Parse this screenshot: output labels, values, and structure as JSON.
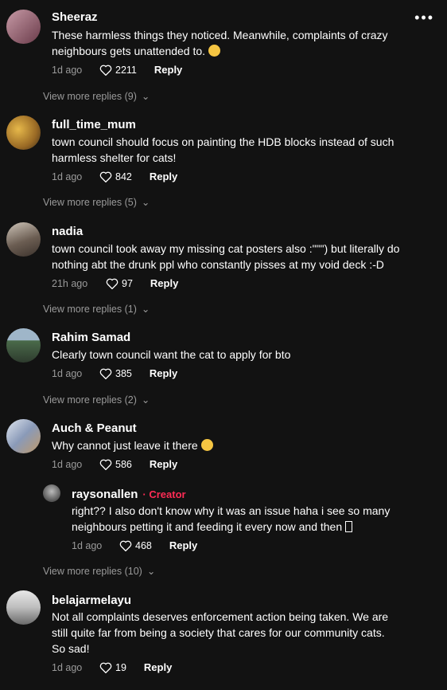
{
  "menu_icon": "more-horizontal-icon",
  "comments": [
    {
      "username": "Sheeraz",
      "text1": "These harmless things they noticed. Meanwhile, complaints of crazy",
      "text2": "neighbours gets unattended to.",
      "emoji": "flushed-face-emoji",
      "time": "1d ago",
      "likes": "2211",
      "reply": "Reply",
      "more": "View more replies (9)",
      "avatar_color": "#8a5a6a"
    },
    {
      "username": "full_time_mum",
      "text1": "town council should focus on painting the HDB blocks instead of such",
      "text2": "harmless shelter for cats!",
      "time": "1d ago",
      "likes": "842",
      "reply": "Reply",
      "more": "View more replies (5)",
      "avatar_color": "#b08a3c"
    },
    {
      "username": "nadia",
      "text1": "town council took away my missing cat posters also :\"\"\") but literally do",
      "text2": "nothing abt the drunk ppl who constantly pisses at my void deck :-D",
      "time": "21h ago",
      "likes": "97",
      "reply": "Reply",
      "more": "View more replies (1)",
      "avatar_color": "#6b5d52"
    },
    {
      "username": "Rahim Samad",
      "text1": "Clearly town council want the cat to apply for bto",
      "time": "1d ago",
      "likes": "385",
      "reply": "Reply",
      "more": "View more replies (2)",
      "avatar_color": "#4a6b4a"
    },
    {
      "username": "Auch & Peanut",
      "text1": "Why cannot just leave it there",
      "emoji": "pleading-face-emoji",
      "time": "1d ago",
      "likes": "586",
      "reply": "Reply",
      "avatar_color": "#8a9ab8"
    },
    {
      "username": "belajarmelayu",
      "text1": "Not all complaints deserves enforcement action being taken. We are",
      "text2": "still quite far from being a society that cares for our community cats.",
      "text3": "So sad!",
      "time": "1d ago",
      "likes": "19",
      "reply": "Reply",
      "avatar_color": "#c9c9c9"
    }
  ],
  "creator_reply": {
    "username": "raysonallen",
    "badge": "Creator",
    "text1": "right?? I also don't know why it was an issue haha i see so many",
    "text2": "neighbours petting it and feeding it every now and then",
    "time": "1d ago",
    "likes": "468",
    "reply": "Reply",
    "avatar_color": "#777777"
  },
  "after_reply_more": "View more replies (10)",
  "colors": {
    "background": "#121212",
    "creator": "#fe2c55",
    "muted": "#9a9a9a"
  }
}
